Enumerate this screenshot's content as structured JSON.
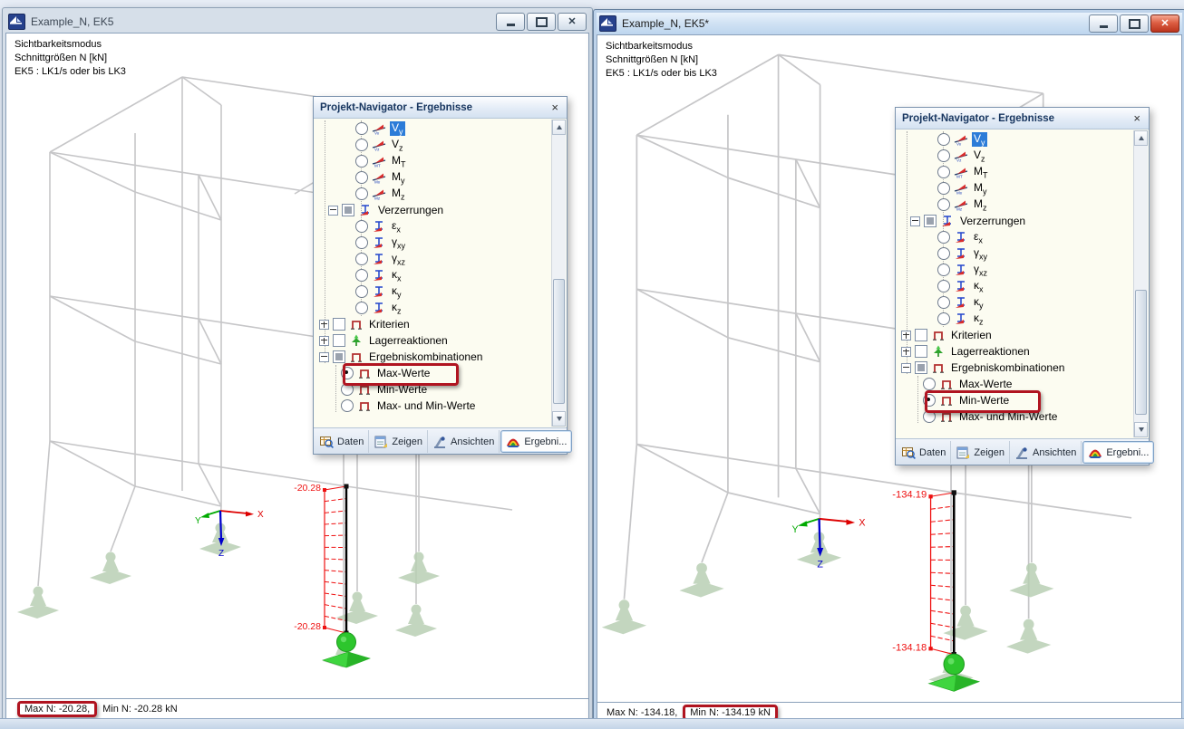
{
  "workspace": {
    "background": "#e7edf6"
  },
  "info_lines": [
    "Sichtbarkeitsmodus",
    "Schnittgrößen N [kN]",
    "EK5 : LK1/s oder bis LK3"
  ],
  "axis": {
    "x": "X",
    "y": "Y",
    "z": "Z"
  },
  "panel": {
    "title": "Projekt-Navigator - Ergebnisse",
    "close_glyph": "×",
    "tabs": [
      {
        "label": "Daten",
        "icon": "daten-icon"
      },
      {
        "label": "Zeigen",
        "icon": "zeigen-icon"
      },
      {
        "label": "Ansichten",
        "icon": "ansichten-icon"
      },
      {
        "label": "Ergebni...",
        "icon": "ergebnisse-icon"
      }
    ],
    "active_tab": 3,
    "items": [
      {
        "main": "V",
        "sub": "y",
        "type": "radio",
        "depth": 3,
        "icon": "force",
        "icon_sub": "Vy",
        "selected_bg": true
      },
      {
        "main": "V",
        "sub": "z",
        "type": "radio",
        "depth": 3,
        "icon": "force",
        "icon_sub": "Vz"
      },
      {
        "main": "M",
        "sub": "T",
        "type": "radio",
        "depth": 3,
        "icon": "force",
        "icon_sub": "MT"
      },
      {
        "main": "M",
        "sub": "y",
        "type": "radio",
        "depth": 3,
        "icon": "force",
        "icon_sub": "My"
      },
      {
        "main": "M",
        "sub": "z",
        "type": "radio",
        "depth": 3,
        "icon": "force",
        "icon_sub": "Mz"
      },
      {
        "main": "Verzerrungen",
        "sub": "",
        "type": "checkbox",
        "state": "partial",
        "expand": "minus",
        "depth": 2,
        "icon": "strain"
      },
      {
        "main": "ε",
        "sub": "x",
        "type": "radio",
        "depth": 3,
        "icon": "strain"
      },
      {
        "main": "γ",
        "sub": "xy",
        "type": "radio",
        "depth": 3,
        "icon": "strain"
      },
      {
        "main": "γ",
        "sub": "xz",
        "type": "radio",
        "depth": 3,
        "icon": "strain"
      },
      {
        "main": "κ",
        "sub": "x",
        "type": "radio",
        "depth": 3,
        "icon": "strain"
      },
      {
        "main": "κ",
        "sub": "y",
        "type": "radio",
        "depth": 3,
        "icon": "strain"
      },
      {
        "main": "κ",
        "sub": "z",
        "type": "radio",
        "depth": 3,
        "icon": "strain"
      },
      {
        "main": "Kriterien",
        "sub": "",
        "type": "checkbox",
        "state": "empty",
        "expand": "plus",
        "depth": 1,
        "icon": "bracket"
      },
      {
        "main": "Lagerreaktionen",
        "sub": "",
        "type": "checkbox",
        "state": "empty",
        "expand": "plus",
        "depth": 1,
        "icon": "support"
      },
      {
        "main": "Ergebniskombinationen",
        "sub": "",
        "type": "checkbox",
        "state": "partial",
        "expand": "minus",
        "depth": 1,
        "icon": "bracket"
      },
      {
        "main": "Max-Werte",
        "sub": "",
        "type": "radio",
        "depth": 2,
        "icon": "bracket"
      },
      {
        "main": "Min-Werte",
        "sub": "",
        "type": "radio",
        "depth": 2,
        "icon": "bracket"
      },
      {
        "main": "Max- und Min-Werte",
        "sub": "",
        "type": "radio",
        "depth": 2,
        "icon": "bracket"
      }
    ]
  },
  "windows": [
    {
      "title": "Example_N, EK5",
      "active": false,
      "diagram": {
        "top_label": "-20.28",
        "bottom_label": "-20.28"
      },
      "selected_item": 15,
      "highlight_item": 15,
      "status": [
        {
          "text": "Max N: -20.28,",
          "boxed": true
        },
        {
          "text": "Min N: -20.28 kN",
          "boxed": false
        }
      ]
    },
    {
      "title": "Example_N, EK5*",
      "active": true,
      "diagram": {
        "top_label": "-134.19",
        "bottom_label": "-134.18"
      },
      "selected_item": 16,
      "highlight_item": 16,
      "status": [
        {
          "text": "Max N: -134.18,",
          "boxed": false
        },
        {
          "text": "Min N: -134.19 kN",
          "boxed": true
        }
      ]
    }
  ],
  "colors": {
    "wireframe": "#c6c6c8",
    "member": "#000000",
    "result_diagram": "#ee1111",
    "support_pale": "#b9cfb4",
    "support_active": "#2dc62d",
    "axis_x": "#dd0000",
    "axis_y": "#00aa00",
    "axis_z": "#0000cc",
    "annotation": "#b01420",
    "selection": "#2c7cd8"
  }
}
